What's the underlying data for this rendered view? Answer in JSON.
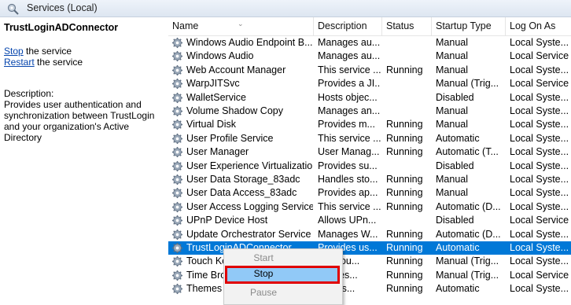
{
  "window": {
    "title": "Services (Local)"
  },
  "left_pane": {
    "service_name": "TrustLoginADConnector",
    "stop_link": "Stop",
    "stop_suffix": " the service",
    "restart_link": "Restart",
    "restart_suffix": " the service",
    "description_label": "Description:",
    "description_text": "Provides user authentication and synchronization between TrustLogin and your organization's Active Directory"
  },
  "columns": [
    "Name",
    "Description",
    "Status",
    "Startup Type",
    "Log On As"
  ],
  "rows": [
    {
      "name": "Windows Audio Endpoint B...",
      "description": "Manages au...",
      "status": "",
      "startup": "Manual",
      "logon": "Local Syste..."
    },
    {
      "name": "Windows Audio",
      "description": "Manages au...",
      "status": "",
      "startup": "Manual",
      "logon": "Local Service"
    },
    {
      "name": "Web Account Manager",
      "description": "This service ...",
      "status": "Running",
      "startup": "Manual",
      "logon": "Local Syste..."
    },
    {
      "name": "WarpJITSvc",
      "description": "Provides a JI...",
      "status": "",
      "startup": "Manual (Trig...",
      "logon": "Local Service"
    },
    {
      "name": "WalletService",
      "description": "Hosts objec...",
      "status": "",
      "startup": "Disabled",
      "logon": "Local Syste..."
    },
    {
      "name": "Volume Shadow Copy",
      "description": "Manages an...",
      "status": "",
      "startup": "Manual",
      "logon": "Local Syste..."
    },
    {
      "name": "Virtual Disk",
      "description": "Provides m...",
      "status": "Running",
      "startup": "Manual",
      "logon": "Local Syste..."
    },
    {
      "name": "User Profile Service",
      "description": "This service ...",
      "status": "Running",
      "startup": "Automatic",
      "logon": "Local Syste..."
    },
    {
      "name": "User Manager",
      "description": "User Manag...",
      "status": "Running",
      "startup": "Automatic (T...",
      "logon": "Local Syste..."
    },
    {
      "name": "User Experience Virtualizatio...",
      "description": "Provides su...",
      "status": "",
      "startup": "Disabled",
      "logon": "Local Syste..."
    },
    {
      "name": "User Data Storage_83adc",
      "description": "Handles sto...",
      "status": "Running",
      "startup": "Manual",
      "logon": "Local Syste..."
    },
    {
      "name": "User Data Access_83adc",
      "description": "Provides ap...",
      "status": "Running",
      "startup": "Manual",
      "logon": "Local Syste..."
    },
    {
      "name": "User Access Logging Service",
      "description": "This service ...",
      "status": "Running",
      "startup": "Automatic (D...",
      "logon": "Local Syste..."
    },
    {
      "name": "UPnP Device Host",
      "description": "Allows UPn...",
      "status": "",
      "startup": "Disabled",
      "logon": "Local Service"
    },
    {
      "name": "Update Orchestrator Service",
      "description": "Manages W...",
      "status": "Running",
      "startup": "Automatic (D...",
      "logon": "Local Syste..."
    },
    {
      "name": "TrustLoginADConnector",
      "description": "Provides us...",
      "status": "Running",
      "startup": "Automatic",
      "logon": "Local Syste...",
      "selected": true
    },
    {
      "name": "Touch Ke",
      "description": "ces Tou...",
      "status": "Running",
      "startup": "Manual (Trig...",
      "logon": "Local Syste..."
    },
    {
      "name": "Time Bro",
      "description": "dinates...",
      "status": "Running",
      "startup": "Manual (Trig...",
      "logon": "Local Service"
    },
    {
      "name": "Themes",
      "description": "des us...",
      "status": "Running",
      "startup": "Automatic",
      "logon": "Local Syste..."
    }
  ],
  "context_menu": {
    "items": [
      {
        "label": "Start",
        "state": "disabled"
      },
      {
        "label": "Stop",
        "state": "highlighted"
      },
      {
        "label": "Pause",
        "state": "disabled"
      }
    ]
  },
  "colors": {
    "selection": "#0078d7",
    "menu_highlight": "#91c9f7",
    "focus_box": "#e00000",
    "link": "#0645ad"
  },
  "icons": {
    "title": "services-icon",
    "row": "gear-icon"
  }
}
